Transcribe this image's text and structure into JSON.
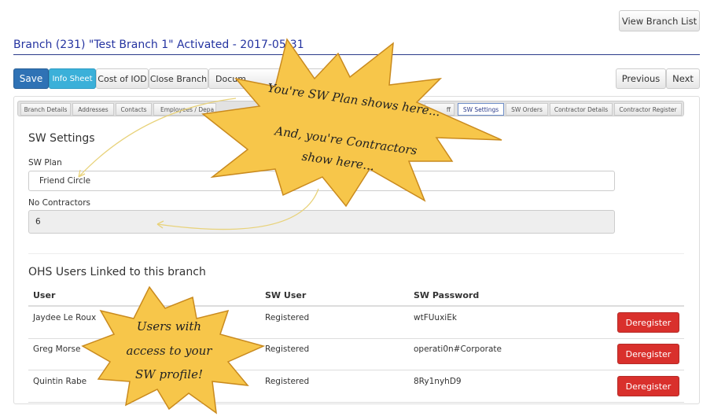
{
  "header": {
    "view_branch_list": "View Branch List",
    "title": "Branch (231) \"Test Branch 1\" Activated",
    "title_sep": " - ",
    "date": "2017-05-31"
  },
  "toolbar": {
    "save": "Save",
    "info_sheet": "Info Sheet",
    "cost_of_iod": "Cost of IOD",
    "close_branch": "Close Branch",
    "documents": "Docum",
    "previous": "Previous",
    "next": "Next"
  },
  "tabs": [
    {
      "label": "Branch Details"
    },
    {
      "label": "Addresses"
    },
    {
      "label": "Contacts"
    },
    {
      "label": "Employees / Depa"
    },
    {
      "label": "ff"
    },
    {
      "label": "SW Settings",
      "active": true
    },
    {
      "label": "SW Orders"
    },
    {
      "label": "Contractor Details"
    },
    {
      "label": "Contractor Register"
    }
  ],
  "sw_settings": {
    "heading": "SW Settings",
    "plan_label": "SW Plan",
    "plan_value": "Friend Circle",
    "contractors_label": "No Contractors",
    "contractors_value": "6"
  },
  "users": {
    "heading": "OHS Users Linked to this branch",
    "columns": [
      "User",
      "SW User",
      "SW Password"
    ],
    "rows": [
      {
        "user": "Jaydee Le Roux",
        "sw_user": "Registered",
        "password": "wtFUuxiEk",
        "action": "Deregister"
      },
      {
        "user": "Greg Morse",
        "sw_user": "Registered",
        "password": "operati0n#Corporate",
        "action": "Deregister"
      },
      {
        "user": "Quintin Rabe",
        "sw_user": "Registered",
        "password": "8Ry1nyhD9",
        "action": "Deregister"
      }
    ]
  },
  "callouts": {
    "star1_line1": "You're SW Plan shows here...",
    "star1_line2": "And, you're Contractors",
    "star1_line3": "show here...",
    "star2_line1": "Users with",
    "star2_line2": "access to your",
    "star2_line3": "SW profile!"
  },
  "colors": {
    "primary": "#2f72b5",
    "info": "#3bb0d9",
    "danger": "#d9302c",
    "title": "#2433a0",
    "star_fill": "#f7c64a",
    "star_stroke": "#c98a1e"
  }
}
